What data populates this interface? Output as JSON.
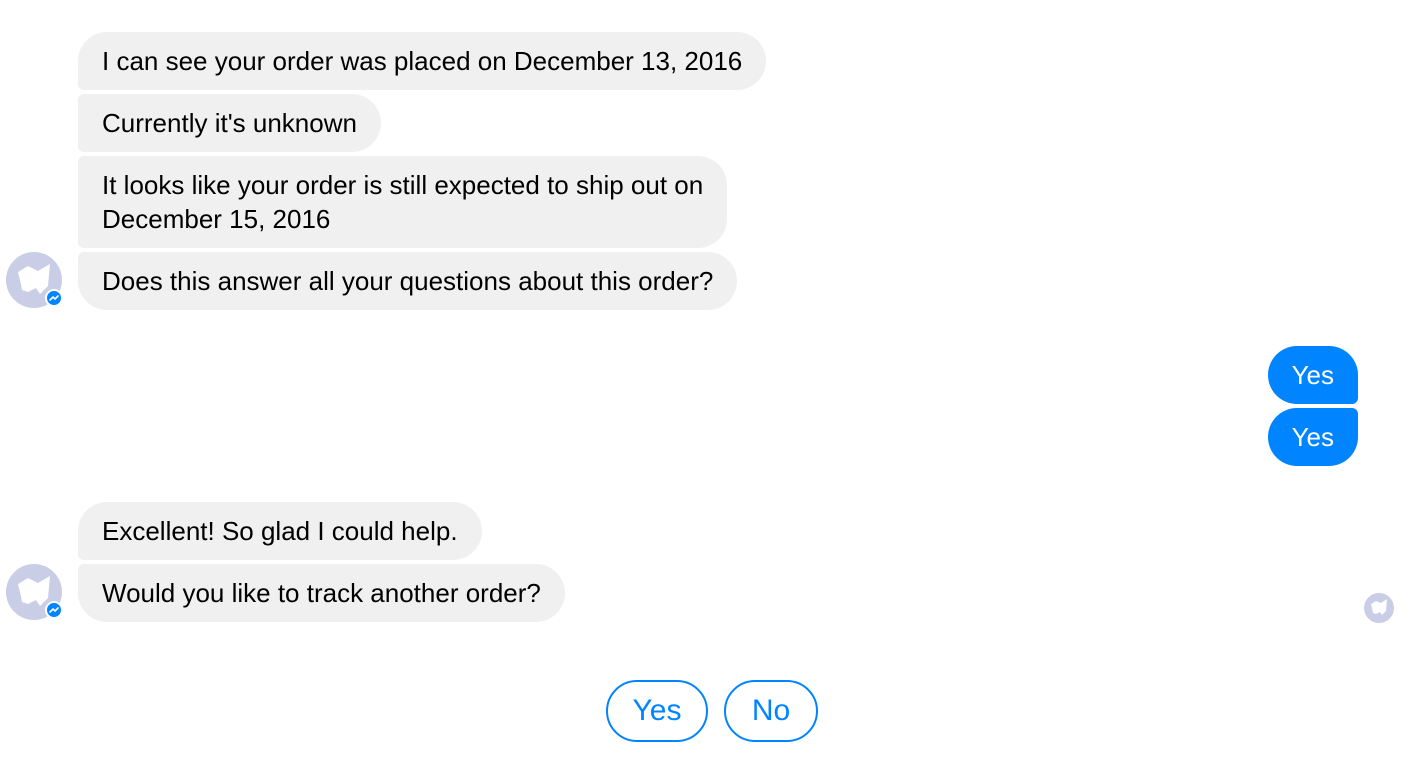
{
  "colors": {
    "bot_bubble": "#f1f0f0",
    "user_bubble": "#0084ff",
    "accent": "#0084ff",
    "avatar": "#c9cde6"
  },
  "messages": [
    {
      "sender": "bot",
      "text": "I can see your order was placed on December 13, 2016"
    },
    {
      "sender": "bot",
      "text": "Currently it's unknown"
    },
    {
      "sender": "bot",
      "lines": [
        "It looks like your order is still expected to ship out on",
        "December 15, 2016"
      ]
    },
    {
      "sender": "bot",
      "text": "Does this answer all your questions about this order?"
    },
    {
      "sender": "user",
      "text": "Yes"
    },
    {
      "sender": "user",
      "text": "Yes"
    },
    {
      "sender": "bot",
      "text": "Excellent! So glad I could help."
    },
    {
      "sender": "bot",
      "text": "Would you like to track another order?"
    }
  ],
  "avatar_icon": "bot-avatar-icon",
  "badge_icon": "messenger-badge-icon",
  "seen_icon": "seen-avatar-icon",
  "quick_replies": [
    "Yes",
    "No"
  ]
}
